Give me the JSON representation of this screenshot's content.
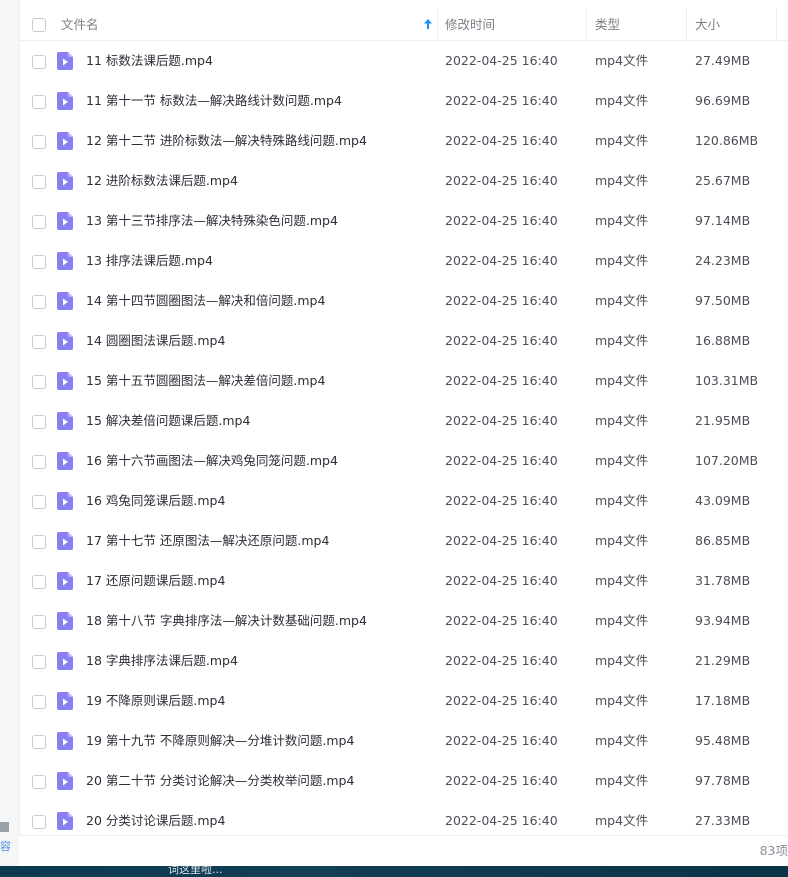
{
  "header": {
    "name_label": "文件名",
    "modified_label": "修改时间",
    "type_label": "类型",
    "size_label": "大小"
  },
  "colors": {
    "accent": "#1a8cff",
    "file_icon": "#8a7ff0"
  },
  "files": [
    {
      "name": "11 标数法课后题.mp4",
      "modified": "2022-04-25 16:40",
      "type": "mp4文件",
      "size": "27.49MB"
    },
    {
      "name": "11 第十一节 标数法—解决路线计数问题.mp4",
      "modified": "2022-04-25 16:40",
      "type": "mp4文件",
      "size": "96.69MB"
    },
    {
      "name": "12 第十二节 进阶标数法—解决特殊路线问题.mp4",
      "modified": "2022-04-25 16:40",
      "type": "mp4文件",
      "size": "120.86MB"
    },
    {
      "name": "12 进阶标数法课后题.mp4",
      "modified": "2022-04-25 16:40",
      "type": "mp4文件",
      "size": "25.67MB"
    },
    {
      "name": "13 第十三节排序法—解决特殊染色问题.mp4",
      "modified": "2022-04-25 16:40",
      "type": "mp4文件",
      "size": "97.14MB"
    },
    {
      "name": "13 排序法课后题.mp4",
      "modified": "2022-04-25 16:40",
      "type": "mp4文件",
      "size": "24.23MB"
    },
    {
      "name": "14 第十四节圆圈图法—解决和倍问题.mp4",
      "modified": "2022-04-25 16:40",
      "type": "mp4文件",
      "size": "97.50MB"
    },
    {
      "name": "14 圆圈图法课后题.mp4",
      "modified": "2022-04-25 16:40",
      "type": "mp4文件",
      "size": "16.88MB"
    },
    {
      "name": "15 第十五节圆圈图法—解决差倍问题.mp4",
      "modified": "2022-04-25 16:40",
      "type": "mp4文件",
      "size": "103.31MB"
    },
    {
      "name": "15 解决差倍问题课后题.mp4",
      "modified": "2022-04-25 16:40",
      "type": "mp4文件",
      "size": "21.95MB"
    },
    {
      "name": "16 第十六节画图法—解决鸡兔同笼问题.mp4",
      "modified": "2022-04-25 16:40",
      "type": "mp4文件",
      "size": "107.20MB"
    },
    {
      "name": "16 鸡兔同笼课后题.mp4",
      "modified": "2022-04-25 16:40",
      "type": "mp4文件",
      "size": "43.09MB"
    },
    {
      "name": "17 第十七节 还原图法—解决还原问题.mp4",
      "modified": "2022-04-25 16:40",
      "type": "mp4文件",
      "size": "86.85MB"
    },
    {
      "name": "17 还原问题课后题.mp4",
      "modified": "2022-04-25 16:40",
      "type": "mp4文件",
      "size": "31.78MB"
    },
    {
      "name": "18 第十八节 字典排序法—解决计数基础问题.mp4",
      "modified": "2022-04-25 16:40",
      "type": "mp4文件",
      "size": "93.94MB"
    },
    {
      "name": "18 字典排序法课后题.mp4",
      "modified": "2022-04-25 16:40",
      "type": "mp4文件",
      "size": "21.29MB"
    },
    {
      "name": "19 不降原则课后题.mp4",
      "modified": "2022-04-25 16:40",
      "type": "mp4文件",
      "size": "17.18MB"
    },
    {
      "name": "19 第十九节 不降原则解决—分堆计数问题.mp4",
      "modified": "2022-04-25 16:40",
      "type": "mp4文件",
      "size": "95.48MB"
    },
    {
      "name": "20 第二十节 分类讨论解决—分类枚举问题.mp4",
      "modified": "2022-04-25 16:40",
      "type": "mp4文件",
      "size": "97.78MB"
    },
    {
      "name": "20 分类讨论课后题.mp4",
      "modified": "2022-04-25 16:40",
      "type": "mp4文件",
      "size": "27.33MB"
    }
  ],
  "footer": {
    "count_text": "83项"
  },
  "left_edge_text": "容",
  "taskbar_text": "词这里啦..."
}
